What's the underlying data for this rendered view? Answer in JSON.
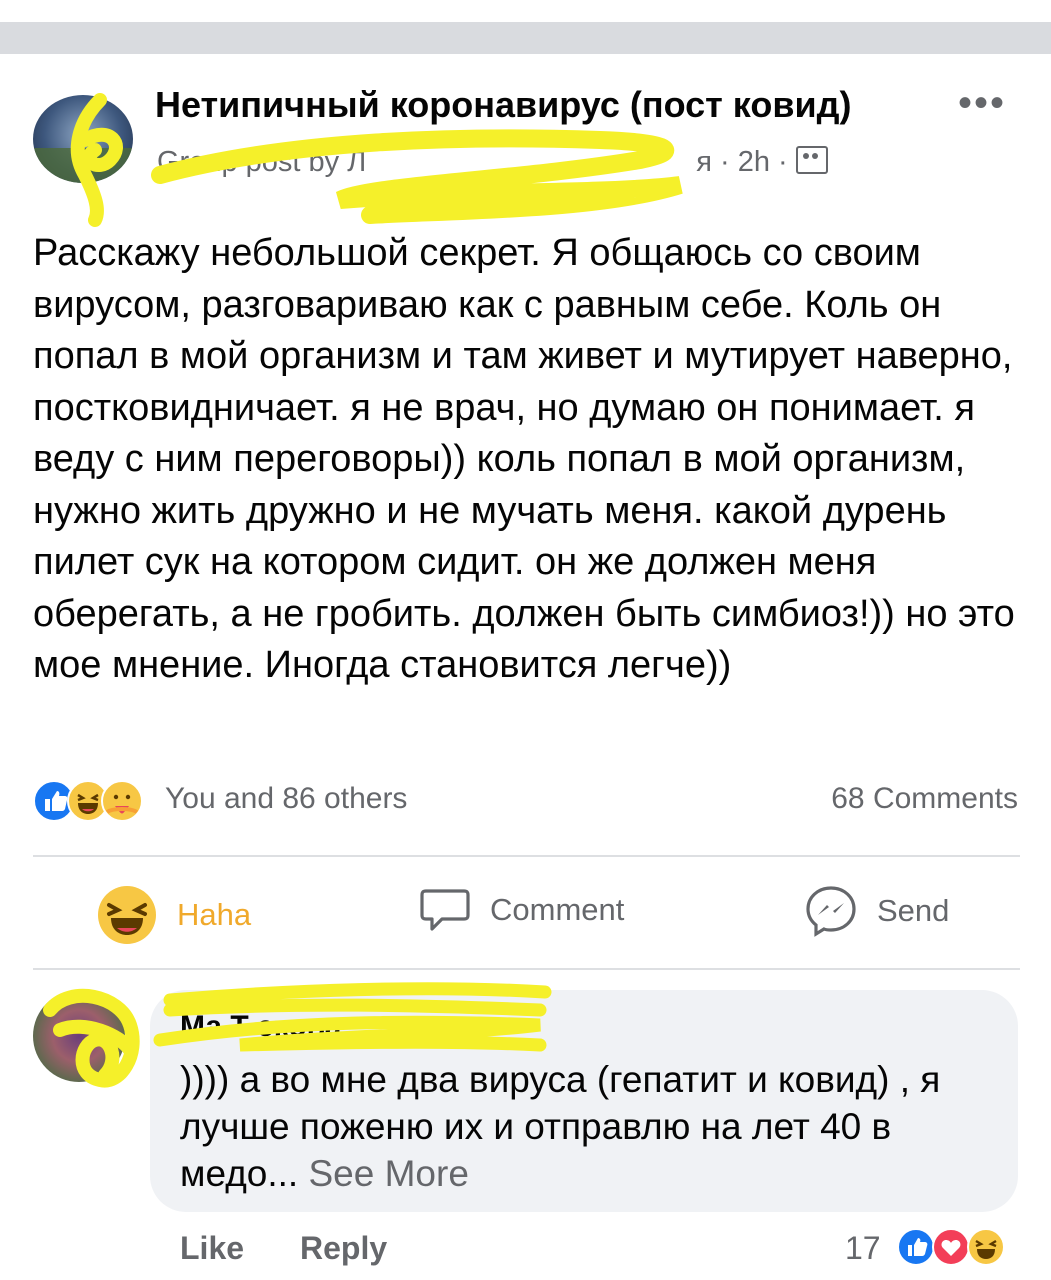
{
  "post": {
    "group_name": "Нетипичный коронавирус (пост ковид)",
    "meta_prefix": "Group post by Л",
    "meta_suffix": "я · 2h ·",
    "more_label": "•••",
    "body": "Расскажу небольшой секрет. Я общаюсь со своим вирусом, разговариваю как с равным себе. Коль он попал в мой организм и там живет и мутирует наверно, постковидничает. я не врач, но думаю он понимает. я веду с ним переговоры)) коль попал в мой организм, нужно жить дружно и не мучать меня. какой дурень пилет сук на котором сидит. он же должен меня оберегать, а не гробить. должен быть симбиоз!)) но это мое мнение. Иногда становится легче))"
  },
  "reactions": {
    "icons": [
      "like-icon",
      "haha-icon",
      "care-icon"
    ],
    "summary": "You and 86 others",
    "comments": "68 Comments"
  },
  "actions": {
    "haha": "Haha",
    "comment": "Comment",
    "send": "Send"
  },
  "comment": {
    "author": "Ма      Т      екова",
    "text": ")))) а во мне два вируса (гепатит и ковид) , я лучше поженю их и отправлю на лет 40 в медо...",
    "see_more": "See More",
    "like": "Like",
    "reply": "Reply",
    "reaction_count": "17",
    "reaction_icons": [
      "like-icon",
      "love-icon",
      "haha-icon"
    ]
  },
  "colors": {
    "brand_blue": "#1877f2",
    "haha_yellow": "#f7c744",
    "secondary_text": "#65676b",
    "highlight_scribble": "#f5f02a"
  }
}
